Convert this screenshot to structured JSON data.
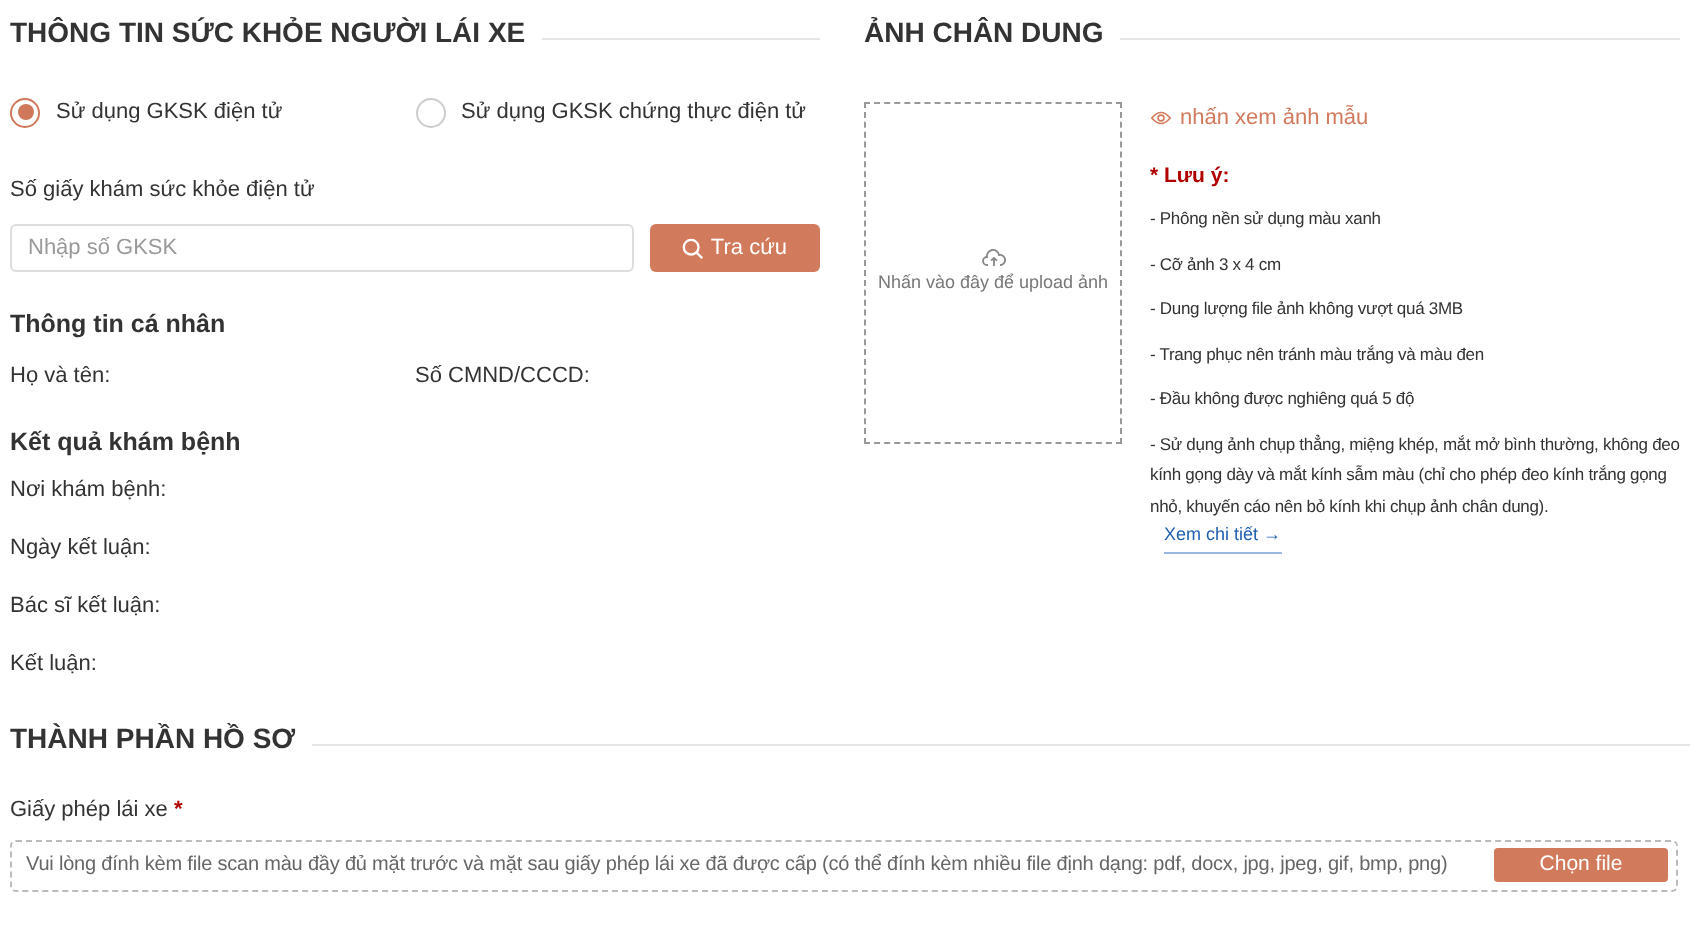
{
  "health": {
    "title": "THÔNG TIN SỨC KHỎE NGƯỜI LÁI XE",
    "options": [
      {
        "label": "Sử dụng GKSK điện tử",
        "selected": true
      },
      {
        "label": "Sử dụng GKSK chứng thực điện tử",
        "selected": false
      }
    ],
    "lookup": {
      "label": "Số giấy khám sức khỏe điện tử",
      "placeholder": "Nhập số GKSK",
      "button": "Tra cứu"
    },
    "personal": {
      "title": "Thông tin cá nhân",
      "fields": [
        "Họ và tên:",
        "Số CMND/CCCD:"
      ]
    },
    "result": {
      "title": "Kết quả khám bệnh",
      "fields": [
        "Nơi khám bệnh:",
        "Ngày kết luận:",
        "Bác sĩ kết luận:",
        "Kết luận:"
      ]
    }
  },
  "portrait": {
    "title": "ẢNH CHÂN DUNG",
    "upload_hint": "Nhấn vào đây để upload ảnh",
    "sample_link": "nhấn xem ảnh mẫu",
    "note_title": "* Lưu ý:",
    "notes": [
      "- Phông nền sử dụng màu xanh",
      "- Cỡ ảnh 3 x 4 cm",
      "- Dung lượng file ảnh không vượt quá 3MB",
      "- Trang phục nên tránh màu trắng và màu đen",
      "- Đầu không được nghiêng quá 5 độ",
      "- Sử dụng ảnh chụp thẳng, miệng khép, mắt mở bình thường, không đeo kính gọng dày và mắt kính sẫm màu (chỉ cho phép đeo kính trắng gọng nhỏ, khuyến cáo nên bỏ kính khi chụp ảnh chân dung)."
    ],
    "detail_link": "Xem chi tiết →"
  },
  "documents": {
    "title": "THÀNH PHẦN HỒ SƠ",
    "items": [
      {
        "label": "Giấy phép lái xe",
        "required_mark": "*",
        "hint": "Vui lòng đính kèm file scan màu đầy đủ mặt trước và mặt sau giấy phép lái xe đã được cấp (có thể đính kèm nhiều file định dạng: pdf, docx, jpg, jpeg, gif, bmp, png)",
        "button": "Chọn file"
      }
    ]
  }
}
